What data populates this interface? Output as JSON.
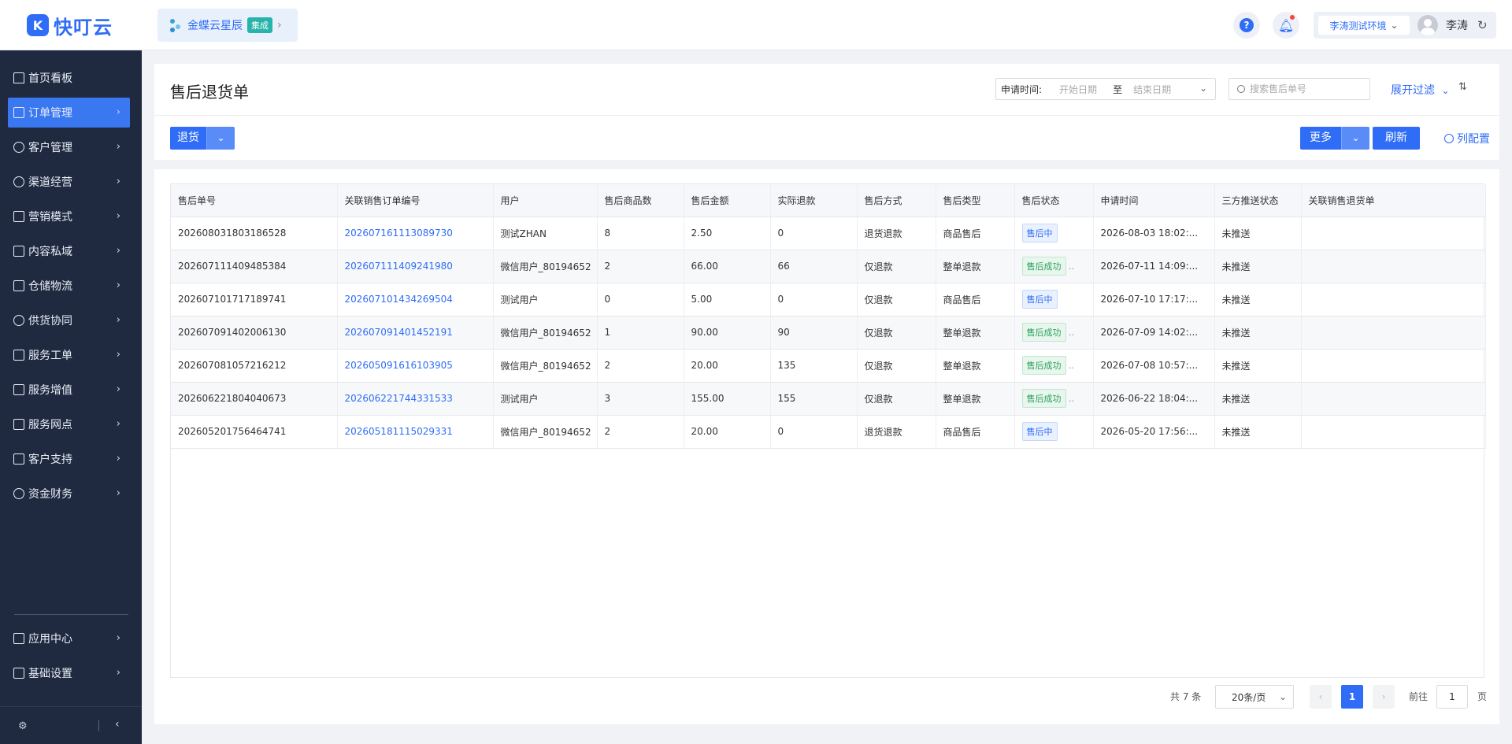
{
  "app": {
    "logo_text": "快叮云",
    "logo_mark": "K"
  },
  "integration": {
    "name": "金蝶云星辰",
    "badge": "集成"
  },
  "header": {
    "env_label": "李涛测试环境",
    "user_name": "李涛",
    "help_icon": "question-icon",
    "bell_icon": "bell-icon"
  },
  "sidebar": {
    "items": [
      {
        "label": "首页看板",
        "icon": "home-icon"
      },
      {
        "label": "订单管理",
        "icon": "order-icon",
        "active": true
      },
      {
        "label": "客户管理",
        "icon": "user-icon"
      },
      {
        "label": "渠道经营",
        "icon": "channel-icon"
      },
      {
        "label": "营销模式",
        "icon": "tag-icon"
      },
      {
        "label": "内容私域",
        "icon": "mail-icon"
      },
      {
        "label": "仓储物流",
        "icon": "warehouse-icon"
      },
      {
        "label": "供货协同",
        "icon": "supplier-icon"
      },
      {
        "label": "服务工单",
        "icon": "ticket-icon"
      },
      {
        "label": "服务增值",
        "icon": "bag-icon"
      },
      {
        "label": "服务网点",
        "icon": "store-icon"
      },
      {
        "label": "客户支持",
        "icon": "support-icon"
      },
      {
        "label": "资金财务",
        "icon": "yen-icon"
      }
    ],
    "bottom_items": [
      {
        "label": "应用中心",
        "icon": "app-center-icon"
      },
      {
        "label": "基础设置",
        "icon": "settings-icon"
      }
    ]
  },
  "page": {
    "title": "售后退货单",
    "date_filter": {
      "label": "申请时间:",
      "start_placeholder": "开始日期",
      "separator": "至",
      "end_placeholder": "结束日期"
    },
    "search_placeholder": "搜索售后单号",
    "expand_filter": "展开过滤",
    "toolbar": {
      "return_button": "退货",
      "more_button": "更多",
      "refresh_button": "刷新",
      "column_config": "列配置"
    }
  },
  "table": {
    "columns": [
      "售后单号",
      "关联销售订单编号",
      "用户",
      "售后商品数",
      "售后金额",
      "实际退款",
      "售后方式",
      "售后类型",
      "售后状态",
      "申请时间",
      "三方推送状态",
      "关联销售退货单"
    ],
    "rows": [
      {
        "id": "202608031803186528",
        "order": "202607161113089730",
        "user": "测试ZHAN",
        "qty": "8",
        "amount": "2.50",
        "refund": "0",
        "method": "退货退款",
        "type": "商品售后",
        "status": "售后中",
        "status_kind": "pending",
        "time": "2026-08-03 18:02:...",
        "push": "未推送",
        "ret": ""
      },
      {
        "id": "202607111409485384",
        "order": "202607111409241980",
        "user": "微信用户_80194652",
        "qty": "2",
        "amount": "66.00",
        "refund": "66",
        "method": "仅退款",
        "type": "整单退款",
        "status": "售后成功",
        "status_kind": "success",
        "time": "2026-07-11 14:09:...",
        "push": "未推送",
        "ret": ""
      },
      {
        "id": "202607101717189741",
        "order": "202607101434269504",
        "user": "测试用户",
        "qty": "0",
        "amount": "5.00",
        "refund": "0",
        "method": "仅退款",
        "type": "商品售后",
        "status": "售后中",
        "status_kind": "pending",
        "time": "2026-07-10 17:17:...",
        "push": "未推送",
        "ret": ""
      },
      {
        "id": "202607091402006130",
        "order": "202607091401452191",
        "user": "微信用户_80194652",
        "qty": "1",
        "amount": "90.00",
        "refund": "90",
        "method": "仅退款",
        "type": "整单退款",
        "status": "售后成功",
        "status_kind": "success",
        "time": "2026-07-09 14:02:...",
        "push": "未推送",
        "ret": ""
      },
      {
        "id": "202607081057216212",
        "order": "202605091616103905",
        "user": "微信用户_80194652",
        "qty": "2",
        "amount": "20.00",
        "refund": "135",
        "method": "仅退款",
        "type": "整单退款",
        "status": "售后成功",
        "status_kind": "success",
        "time": "2026-07-08 10:57:...",
        "push": "未推送",
        "ret": ""
      },
      {
        "id": "202606221804040673",
        "order": "202606221744331533",
        "user": "测试用户",
        "qty": "3",
        "amount": "155.00",
        "refund": "155",
        "method": "仅退款",
        "type": "整单退款",
        "status": "售后成功",
        "status_kind": "success",
        "time": "2026-06-22 18:04:...",
        "push": "未推送",
        "ret": ""
      },
      {
        "id": "202605201756464741",
        "order": "202605181115029331",
        "user": "微信用户_80194652",
        "qty": "2",
        "amount": "20.00",
        "refund": "0",
        "method": "退货退款",
        "type": "商品售后",
        "status": "售后中",
        "status_kind": "pending",
        "time": "2026-05-20 17:56:...",
        "push": "未推送",
        "ret": ""
      }
    ]
  },
  "pagination": {
    "total_text": "共 7 条",
    "page_size": "20条/页",
    "current_page": "1",
    "goto_label": "前往",
    "goto_value": "1",
    "page_unit": "页"
  }
}
